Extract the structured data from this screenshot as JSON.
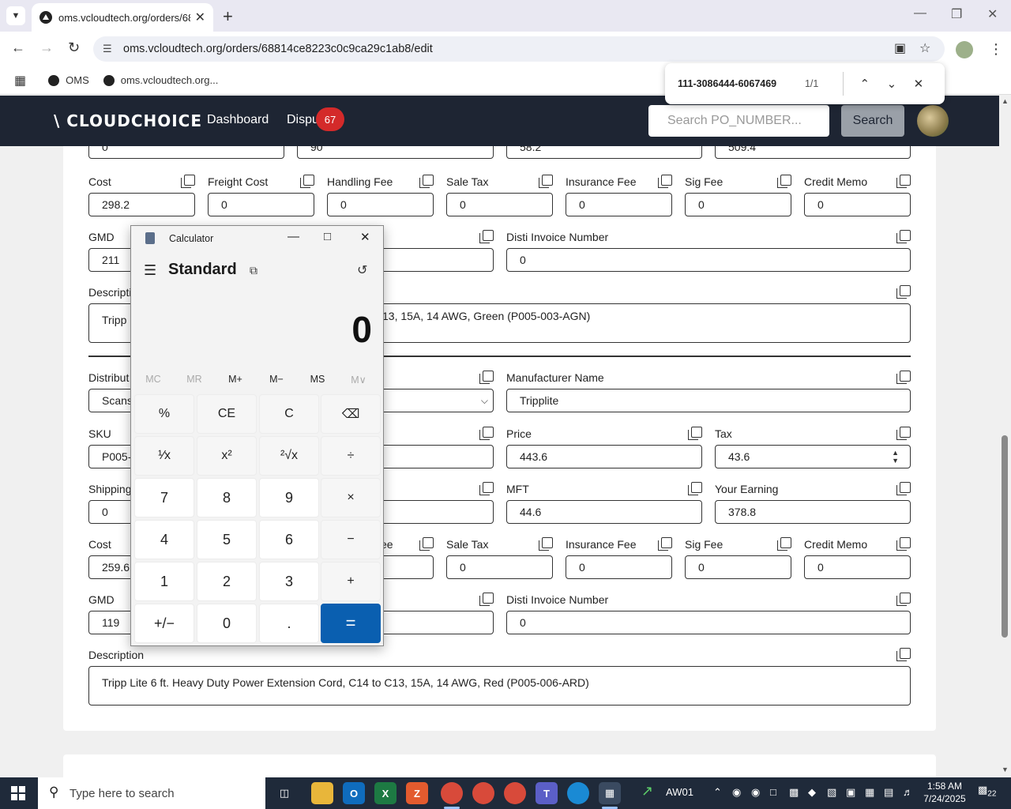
{
  "browser": {
    "tab_title": "oms.vcloudtech.org/orders/688",
    "url": "oms.vcloudtech.org/orders/68814ce8223c0c9ca29c1ab8/edit",
    "bookmarks": [
      "OMS",
      "oms.vcloudtech.org..."
    ],
    "find": {
      "query": "111-3086444-6067469",
      "count": "1/1"
    }
  },
  "header": {
    "logo": "\\ CLOUDCHOICE",
    "nav": [
      "Dashboard",
      "Dispu"
    ],
    "badge": "67",
    "search_placeholder": "Search PO_NUMBER...",
    "search_button": "Search"
  },
  "item1": {
    "top_values": [
      "0",
      "90",
      "58.2",
      "509.4"
    ],
    "labels": {
      "cost": "Cost",
      "freight": "Freight Cost",
      "handling": "Handling Fee",
      "sale_tax": "Sale Tax",
      "insurance": "Insurance Fee",
      "sig": "Sig Fee",
      "credit": "Credit Memo",
      "gmd": "GMD",
      "disti": "Disti Invoice Number",
      "description": "Descripti"
    },
    "values": {
      "cost": "298.2",
      "freight": "0",
      "handling": "0",
      "sale_tax": "0",
      "insurance": "0",
      "sig": "0",
      "credit": "0",
      "gmd": "211",
      "disti": "0"
    },
    "description_left": "Tripp",
    "description_right": "13, 15A, 14 AWG, Green (P005-003-AGN)"
  },
  "item2": {
    "labels": {
      "distributor": "Distribut",
      "manufacturer": "Manufacturer Name",
      "sku": "SKU",
      "price": "Price",
      "tax": "Tax",
      "shipping": "Shipping",
      "mft": "MFT",
      "earning": "Your Earning",
      "cost": "Cost",
      "handling_partial": "ee",
      "sale_tax": "Sale Tax",
      "insurance": "Insurance Fee",
      "sig": "Sig Fee",
      "credit": "Credit Memo",
      "gmd": "GMD",
      "disti": "Disti Invoice Number",
      "description": "Description"
    },
    "values": {
      "distributor": "Scans",
      "manufacturer": "Tripplite",
      "sku": "P005-",
      "price": "443.6",
      "tax": "43.6",
      "shipping": "0",
      "mft": "44.6",
      "earning": "378.8",
      "cost": "259.6",
      "sale_tax": "0",
      "insurance": "0",
      "sig": "0",
      "credit": "0",
      "gmd": "119",
      "disti": "0"
    },
    "description": "Tripp Lite 6 ft. Heavy Duty Power Extension Cord, C14 to C13, 15A, 14 AWG, Red (P005-006-ARD)"
  },
  "calculator": {
    "title": "Calculator",
    "mode": "Standard",
    "display": "0",
    "memory": [
      "MC",
      "MR",
      "M+",
      "M−",
      "MS",
      "M∨"
    ],
    "keys": [
      [
        "%",
        "CE",
        "C",
        "⌫"
      ],
      [
        "¹⁄x",
        "x²",
        "²√x",
        "÷"
      ],
      [
        "7",
        "8",
        "9",
        "×"
      ],
      [
        "4",
        "5",
        "6",
        "−"
      ],
      [
        "1",
        "2",
        "3",
        "+"
      ],
      [
        "+/−",
        "0",
        ".",
        "="
      ]
    ]
  },
  "taskbar": {
    "search_placeholder": "Type here to search",
    "weather_label": "AW01",
    "time": "1:58 AM",
    "date": "7/24/2025",
    "notifications": "22"
  },
  "colors": {
    "header_bg": "#1e2533",
    "badge": "#d42a2a",
    "equals": "#0a5fb0"
  }
}
